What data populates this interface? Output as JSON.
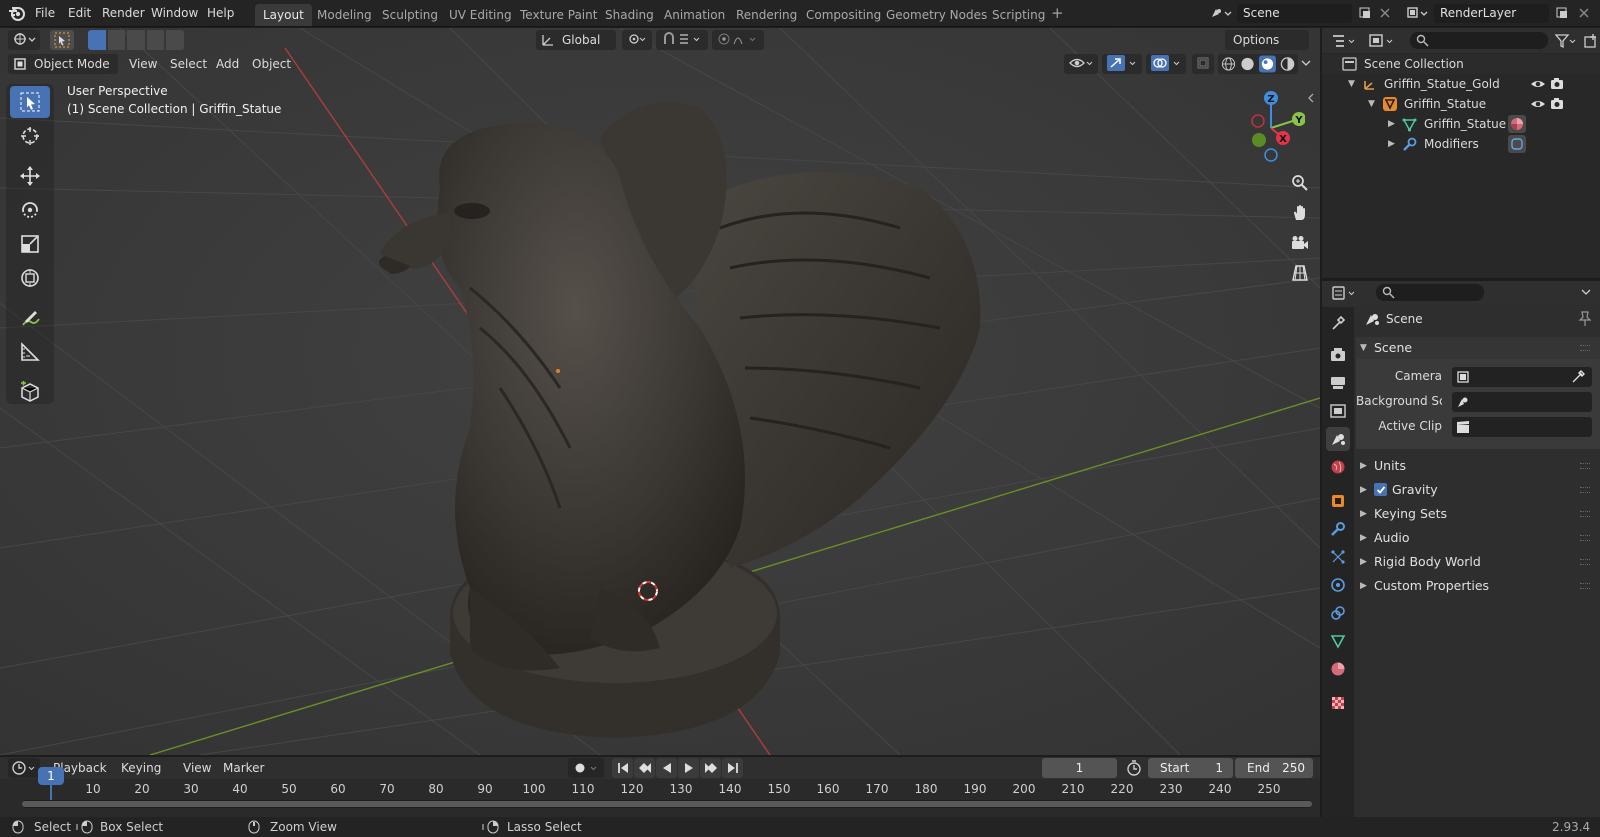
{
  "menu": [
    "File",
    "Edit",
    "Render",
    "Window",
    "Help"
  ],
  "workspaces": [
    "Layout",
    "Modeling",
    "Sculpting",
    "UV Editing",
    "Texture Paint",
    "Shading",
    "Animation",
    "Rendering",
    "Compositing",
    "Geometry Nodes",
    "Scripting"
  ],
  "active_workspace": "Layout",
  "scene_field": "Scene",
  "layer_field": "RenderLayer",
  "viewport": {
    "transform_orientation": "Global",
    "options_label": "Options",
    "mode": "Object Mode",
    "header_menus": [
      "View",
      "Select",
      "Add",
      "Object"
    ],
    "overlay_line1": "User Perspective",
    "overlay_line2": "(1) Scene Collection | Griffin_Statue",
    "axes": {
      "x": "X",
      "y": "Y",
      "z": "Z"
    }
  },
  "outliner": {
    "root": "Scene Collection",
    "items": [
      {
        "label": "Griffin_Statue_Gold"
      },
      {
        "label": "Griffin_Statue"
      },
      {
        "label": "Griffin_Statue"
      },
      {
        "label": "Modifiers"
      }
    ]
  },
  "properties": {
    "context": "Scene",
    "panel_title": "Scene",
    "fields": {
      "camera": "Camera",
      "background": "Background Sce...",
      "clip": "Active Clip"
    },
    "sections": [
      "Units",
      "Gravity",
      "Keying Sets",
      "Audio",
      "Rigid Body World",
      "Custom Properties"
    ],
    "gravity_checked": true
  },
  "timeline": {
    "menus": [
      "Playback",
      "Keying",
      "View",
      "Marker"
    ],
    "current_frame": "1",
    "start_label": "Start",
    "start_value": "1",
    "end_label": "End",
    "end_value": "250",
    "ticks": [
      "10",
      "20",
      "30",
      "40",
      "50",
      "60",
      "70",
      "80",
      "90",
      "100",
      "110",
      "120",
      "130",
      "140",
      "150",
      "160",
      "170",
      "180",
      "190",
      "200",
      "210",
      "220",
      "230",
      "240",
      "250"
    ],
    "playhead": "1"
  },
  "status": {
    "select": "Select",
    "box_select": "Box Select",
    "zoom_view": "Zoom View",
    "lasso_select": "Lasso Select",
    "version": "2.93.4"
  },
  "colors": {
    "accent": "#4772b3",
    "x_axis": "#e2344a",
    "y_axis": "#8bc34a",
    "z_axis": "#3d8fdf",
    "timeline_line_x": "#b03c3c",
    "timeline_line_y": "#6b8f24"
  }
}
